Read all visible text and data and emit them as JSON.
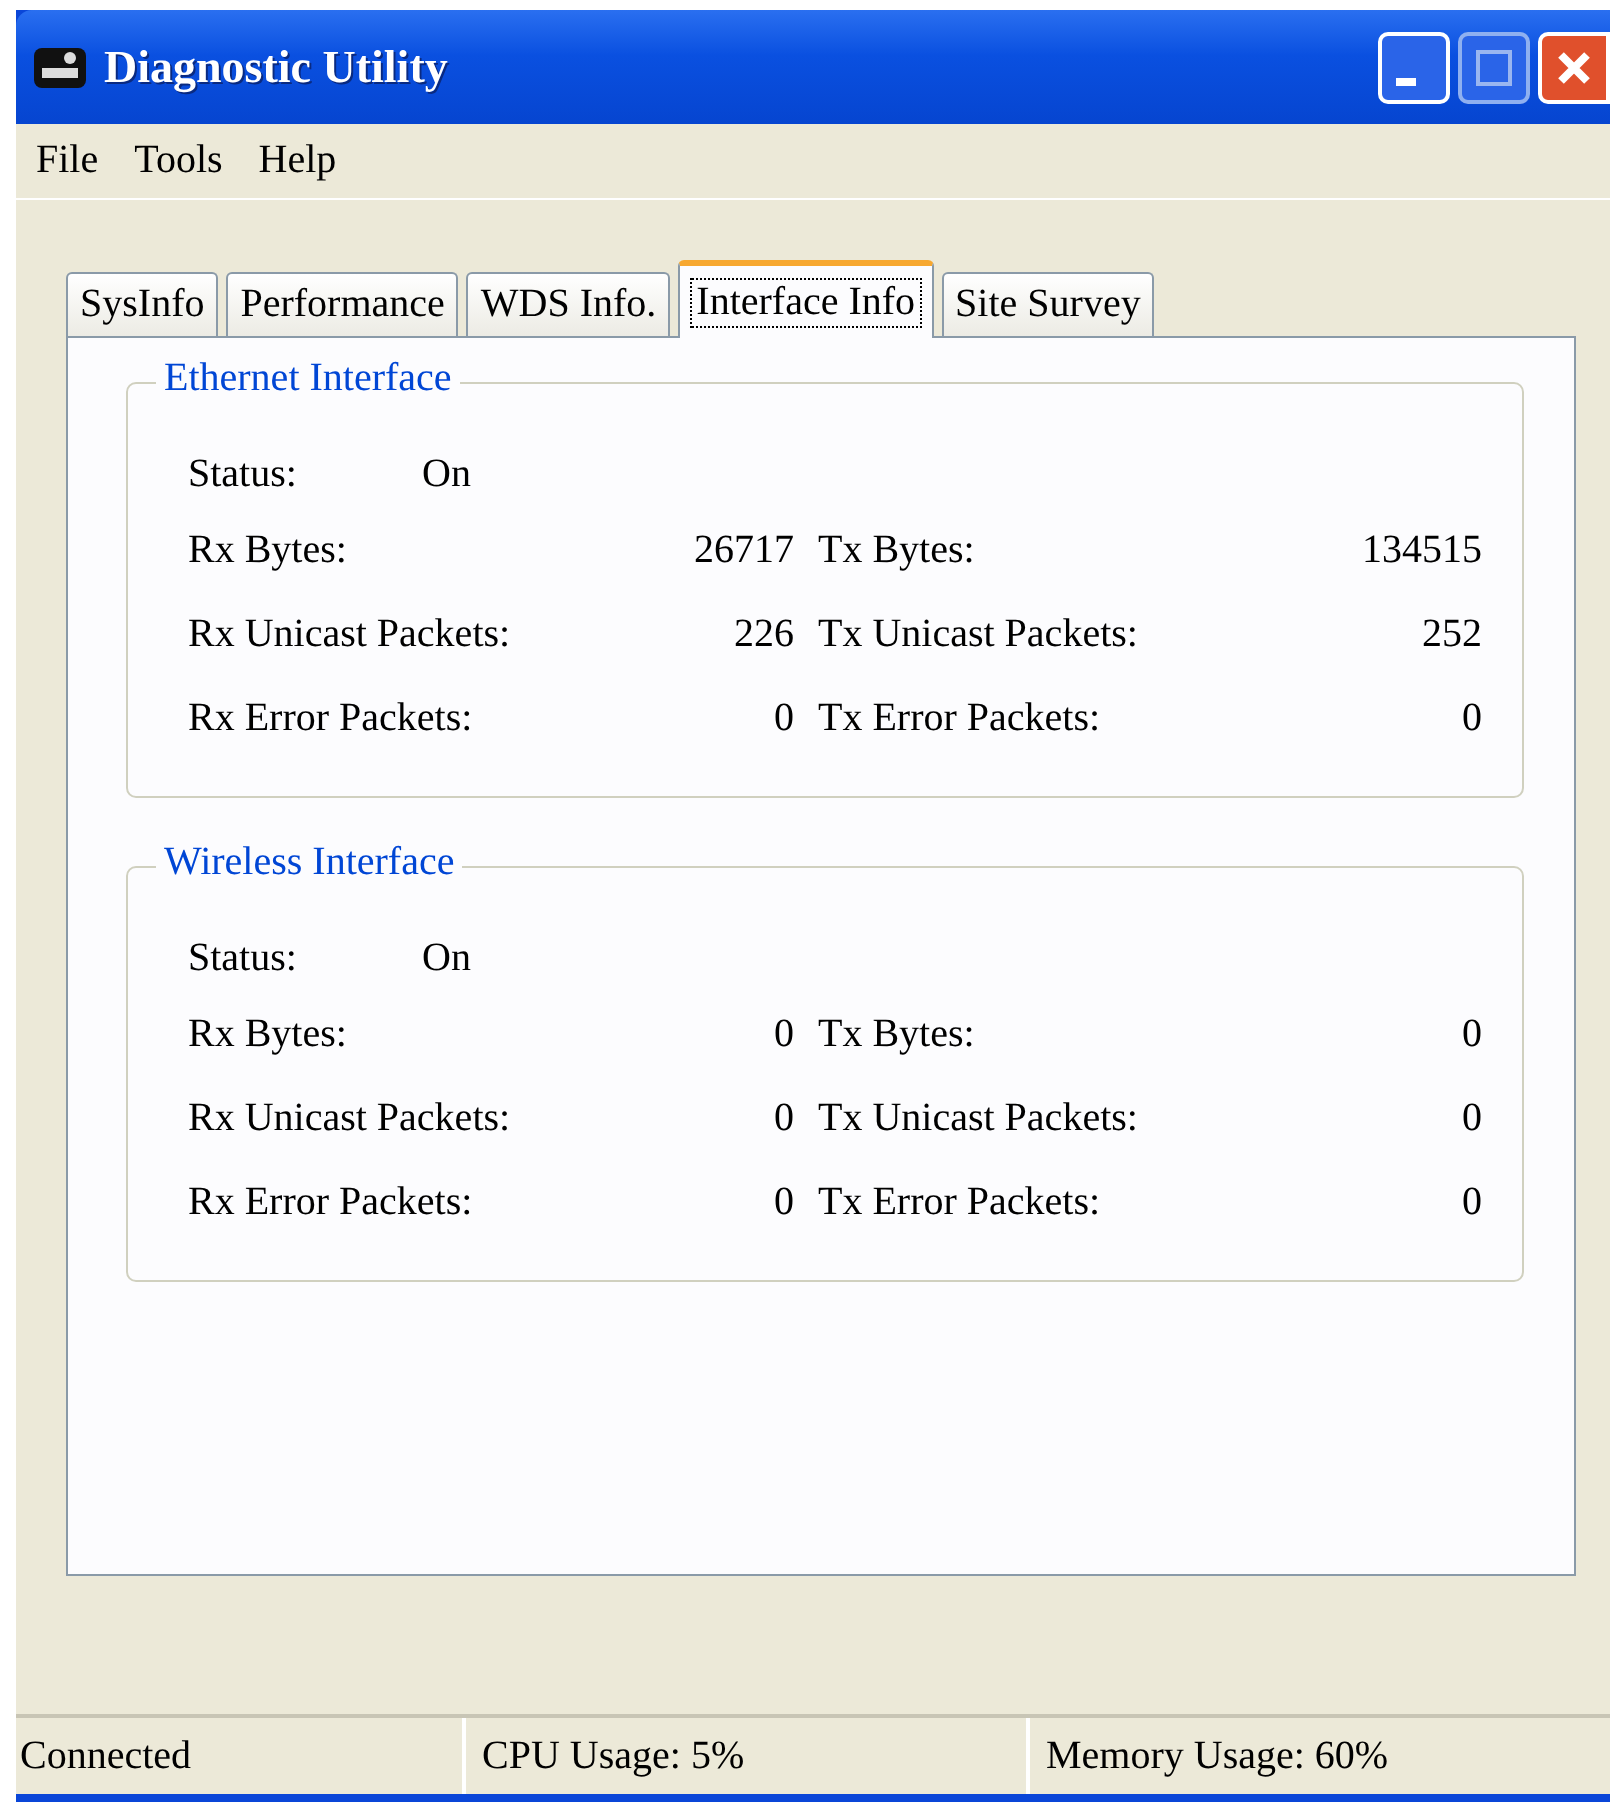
{
  "window": {
    "title": "Diagnostic Utility"
  },
  "menu": [
    "File",
    "Tools",
    "Help"
  ],
  "tabs": [
    {
      "label": "SysInfo",
      "selected": false
    },
    {
      "label": "Performance",
      "selected": false
    },
    {
      "label": "WDS Info.",
      "selected": false
    },
    {
      "label": "Interface Info",
      "selected": true
    },
    {
      "label": "Site Survey",
      "selected": false
    }
  ],
  "groups": [
    {
      "title": "Ethernet Interface",
      "status_label": "Status:",
      "status_value": "On",
      "rows": [
        {
          "rx_label": "Rx Bytes:",
          "rx_value": "26717",
          "tx_label": "Tx Bytes:",
          "tx_value": "134515"
        },
        {
          "rx_label": "Rx Unicast Packets:",
          "rx_value": "226",
          "tx_label": "Tx Unicast Packets:",
          "tx_value": "252"
        },
        {
          "rx_label": "Rx Error Packets:",
          "rx_value": "0",
          "tx_label": "Tx Error Packets:",
          "tx_value": "0"
        }
      ]
    },
    {
      "title": "Wireless Interface",
      "status_label": "Status:",
      "status_value": "On",
      "rows": [
        {
          "rx_label": "Rx Bytes:",
          "rx_value": "0",
          "tx_label": "Tx Bytes:",
          "tx_value": "0"
        },
        {
          "rx_label": "Rx Unicast Packets:",
          "rx_value": "0",
          "tx_label": "Tx Unicast Packets:",
          "tx_value": "0"
        },
        {
          "rx_label": "Rx Error Packets:",
          "rx_value": "0",
          "tx_label": "Tx Error Packets:",
          "tx_value": "0"
        }
      ]
    }
  ],
  "status_bar": [
    "Connected",
    "CPU Usage: 5%",
    "Memory Usage: 60%"
  ]
}
